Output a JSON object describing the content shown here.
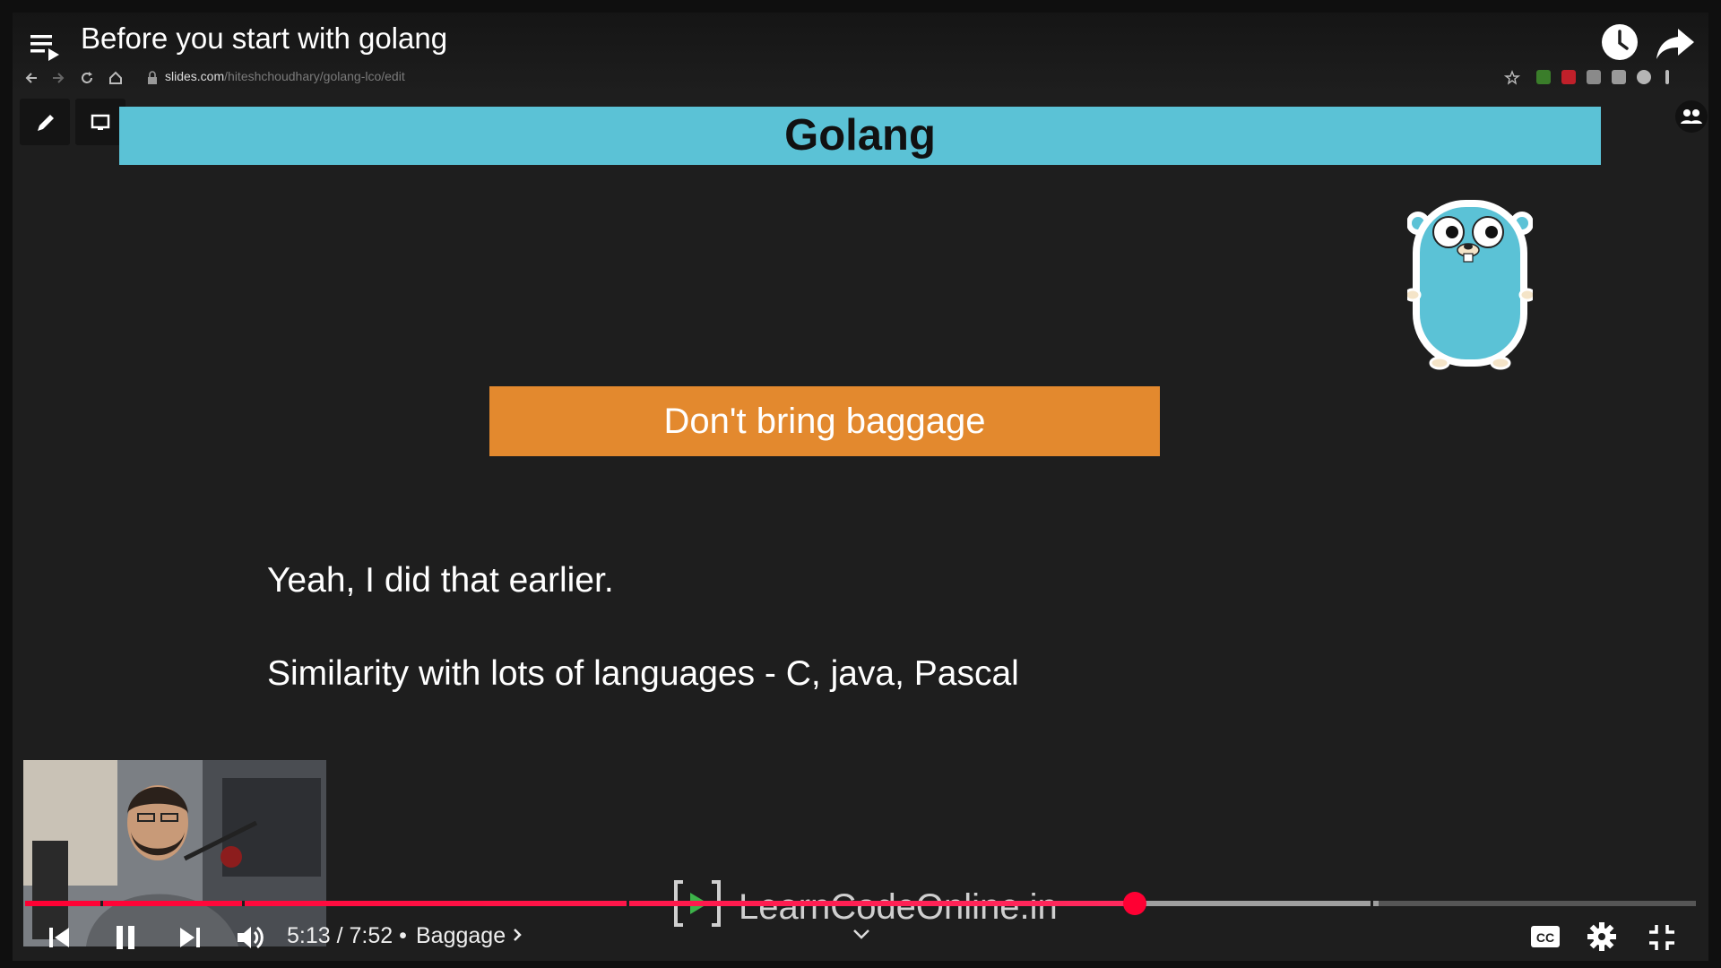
{
  "video": {
    "title": "Before you start with golang",
    "current_time": "5:13",
    "duration": "7:52",
    "time_separator": "/",
    "chapter_separator": "•",
    "chapter": "Baggage",
    "progress_fraction": 0.664,
    "buffered_fraction": 0.81,
    "chapter_marks_fraction": [
      0.045,
      0.13,
      0.36,
      0.805
    ]
  },
  "browser": {
    "url_domain": "slides.com",
    "url_path": "/hiteshchoudhary/golang-lco/edit"
  },
  "slide": {
    "header": "Golang",
    "highlight": "Don't bring baggage",
    "bullets": [
      "Yeah, I did that earlier.",
      "Similarity with lots of languages - C, java, Pascal"
    ]
  },
  "watermark": {
    "text": "LearnCodeOnline.in"
  },
  "colors": {
    "header_bg": "#5bc2d6",
    "highlight_bg": "#e3892e",
    "progress": "#ff0033",
    "gopher": "#5bc2d6"
  },
  "icons": [
    "playlist-icon",
    "clock-icon",
    "share-icon",
    "back-icon",
    "forward-icon",
    "reload-icon",
    "home-icon",
    "star-icon",
    "pen-icon",
    "present-icon",
    "people-icon",
    "gopher-mascot",
    "skip-previous-icon",
    "pause-icon",
    "skip-next-icon",
    "volume-icon",
    "chevron-right-icon",
    "chevron-down-icon",
    "captions-icon",
    "settings-icon",
    "exit-fullscreen-icon"
  ]
}
